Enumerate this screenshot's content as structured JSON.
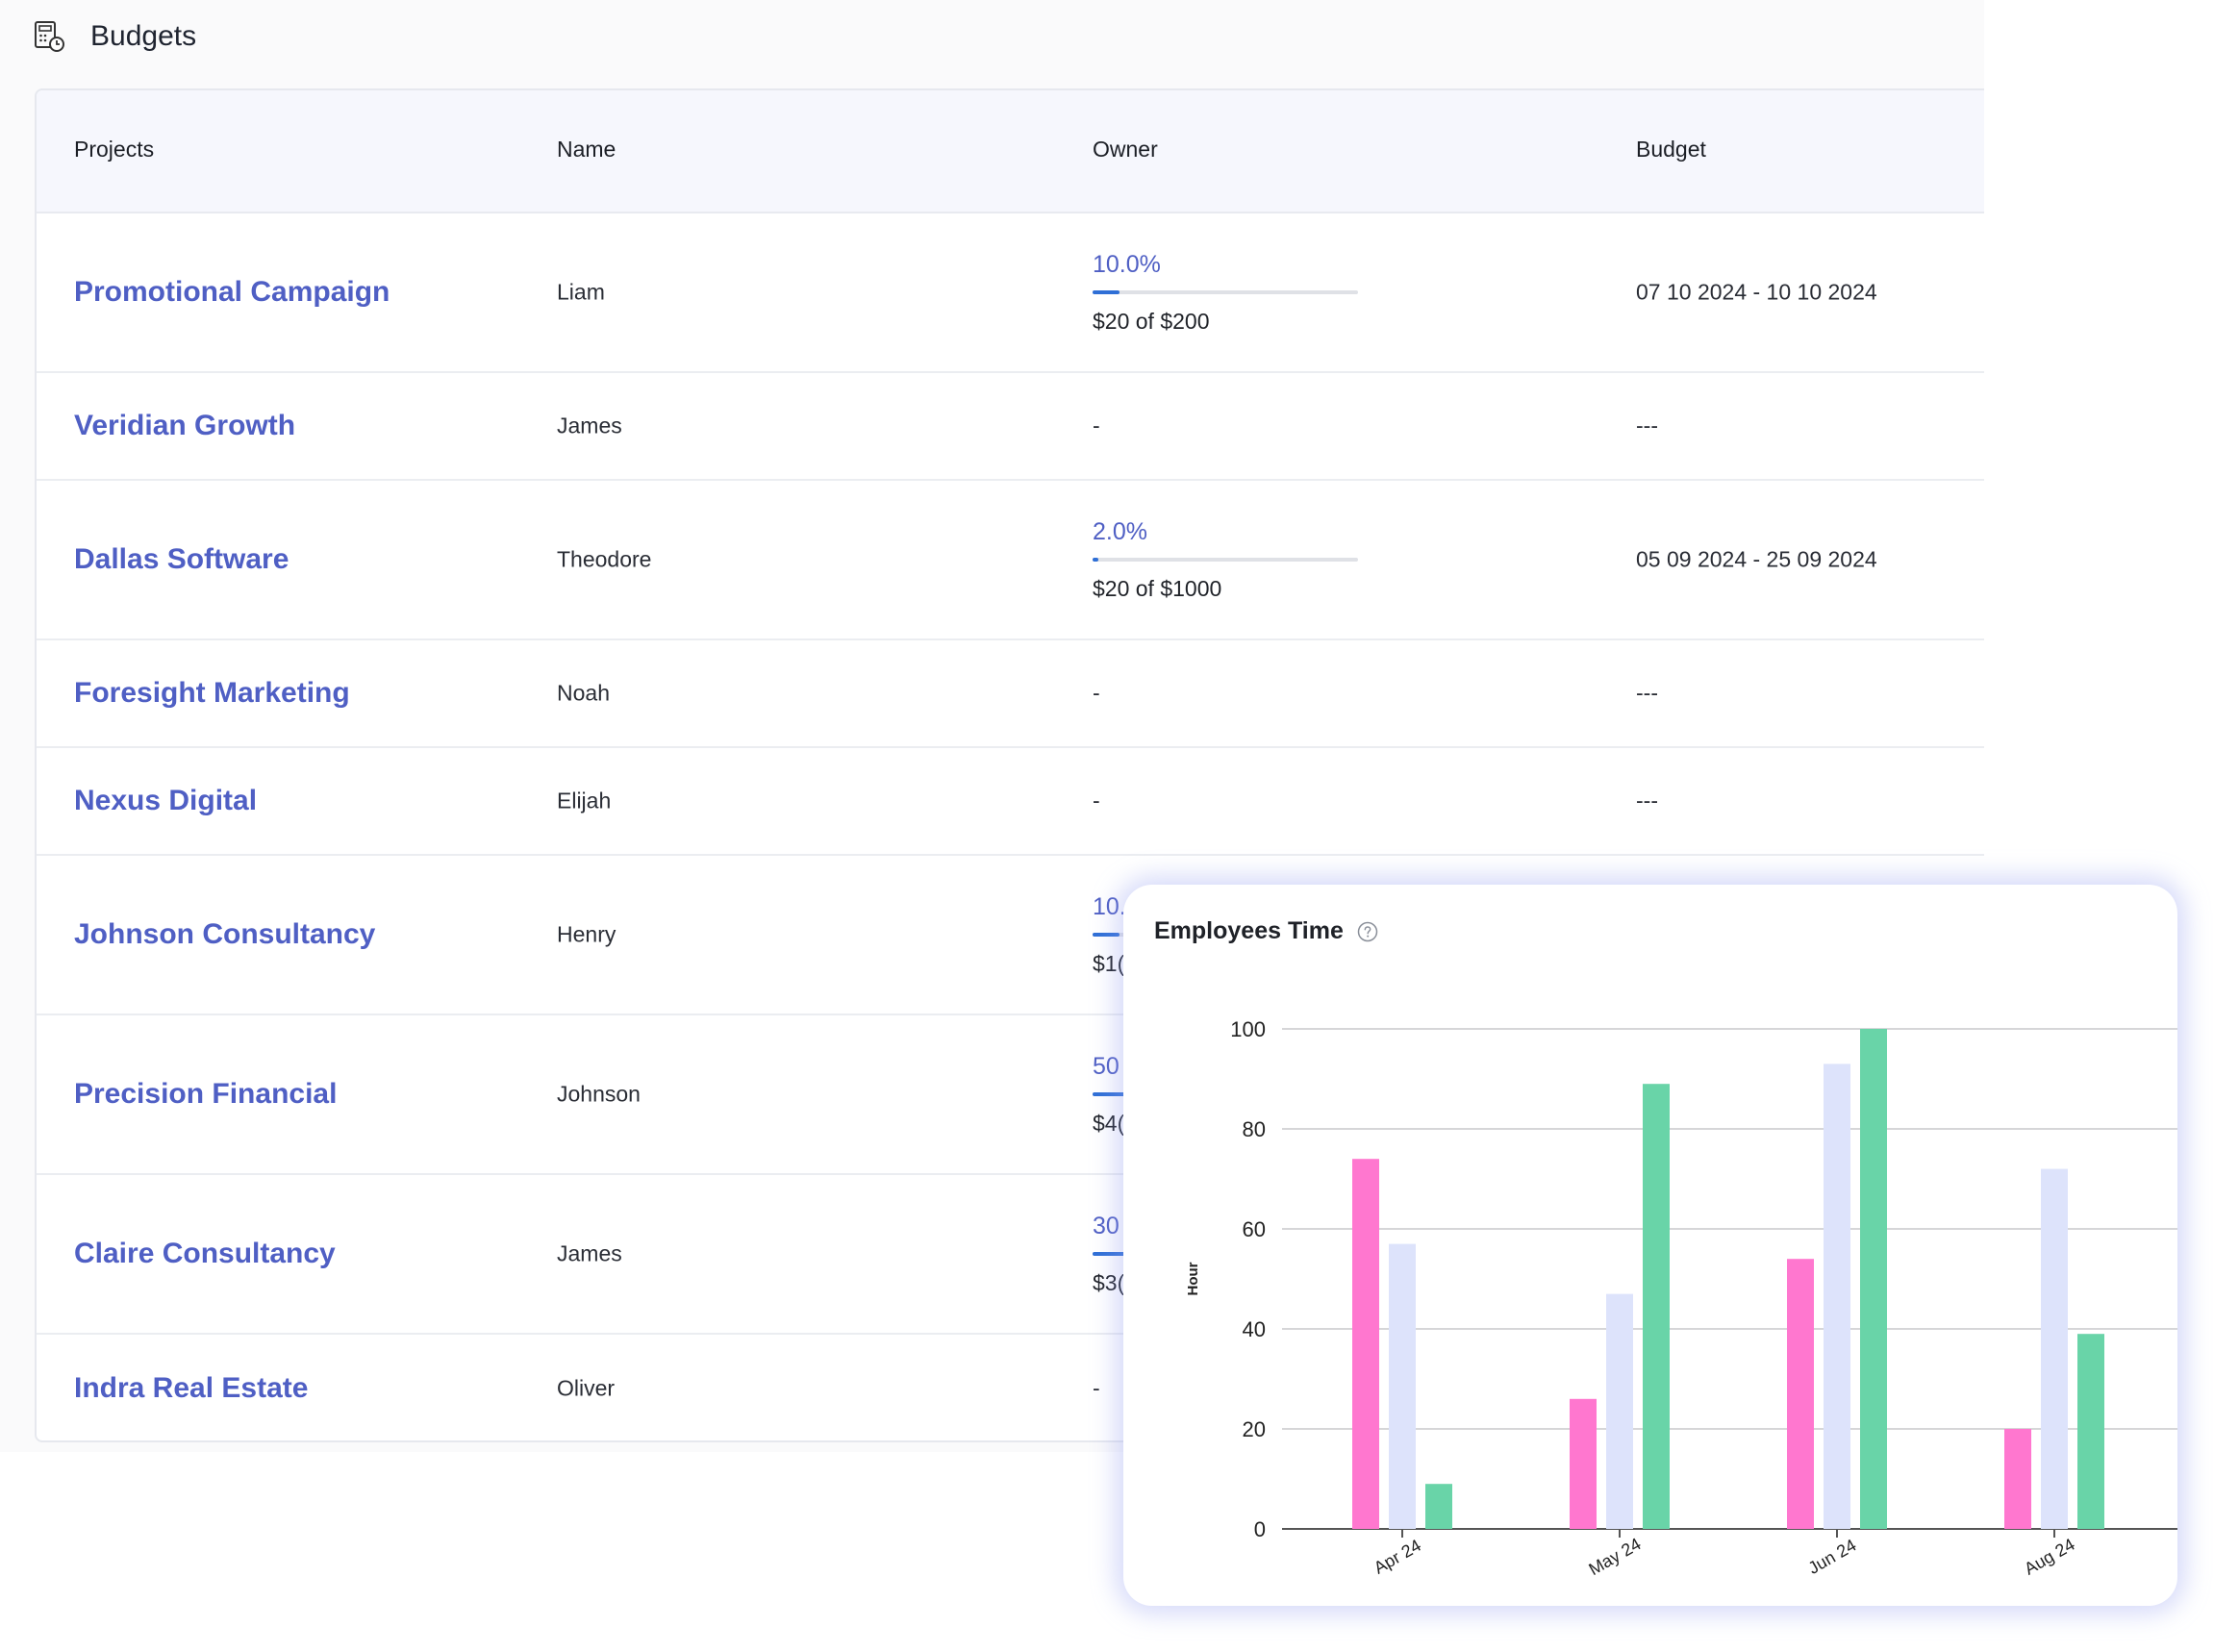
{
  "page": {
    "title": "Budgets",
    "header_icon": "budget-calculator-icon"
  },
  "table": {
    "headers": [
      "Projects",
      "Name",
      "Owner",
      "Budget"
    ],
    "rows": [
      {
        "project": "Promotional Campaign",
        "name": "Liam",
        "owner": {
          "percent": "10.0%",
          "progress": 0.1,
          "amount": "$20 of $200"
        },
        "budget": "07 10 2024 - 10 10 2024"
      },
      {
        "project": "Veridian Growth",
        "name": "James",
        "owner": {
          "text": "-"
        },
        "budget": "---"
      },
      {
        "project": "Dallas Software",
        "name": "Theodore",
        "owner": {
          "percent": "2.0%",
          "progress": 0.02,
          "amount": "$20 of $1000"
        },
        "budget": "05 09 2024 - 25 09 2024"
      },
      {
        "project": "Foresight Marketing",
        "name": "Noah",
        "owner": {
          "text": "-"
        },
        "budget": "---"
      },
      {
        "project": "Nexus Digital",
        "name": "Elijah",
        "owner": {
          "text": "-"
        },
        "budget": "---"
      },
      {
        "project": "Johnson Consultancy",
        "name": "Henry",
        "owner": {
          "percent": "10.",
          "progress": 0.1,
          "amount": "$1("
        },
        "budget": ""
      },
      {
        "project": "Precision Financial",
        "name": "Johnson",
        "owner": {
          "percent": "50",
          "progress": 0.5,
          "amount": "$4("
        },
        "budget": ""
      },
      {
        "project": "Claire Consultancy",
        "name": "James",
        "owner": {
          "percent": "30",
          "progress": 0.3,
          "amount": "$3("
        },
        "budget": ""
      },
      {
        "project": "Indra Real Estate",
        "name": "Oliver",
        "owner": {
          "text": "-"
        },
        "budget": ""
      }
    ]
  },
  "chart_widget": {
    "title": "Employees Time",
    "help_icon": "question-circle-icon"
  },
  "chart_data": {
    "type": "bar",
    "title": "Employees Time",
    "ylabel": "Hour",
    "xlabel": "",
    "categories": [
      "Apr 24",
      "May 24",
      "Jun 24",
      "Aug 24"
    ],
    "yticks": [
      0,
      20,
      40,
      60,
      80,
      100
    ],
    "ylim": [
      0,
      100
    ],
    "grid": true,
    "series": [
      {
        "values": [
          74,
          26,
          54,
          20
        ],
        "color": "#ff77cf"
      },
      {
        "values": [
          57,
          47,
          93,
          72
        ],
        "color": "#dde3fb"
      },
      {
        "values": [
          9,
          89,
          100,
          39
        ],
        "color": "#69d4a8"
      }
    ]
  }
}
